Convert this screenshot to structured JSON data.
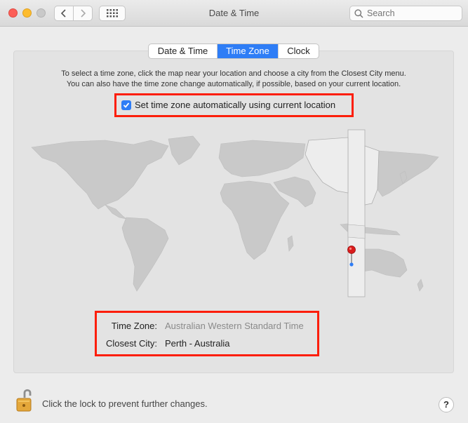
{
  "window": {
    "title": "Date & Time"
  },
  "search": {
    "placeholder": "Search"
  },
  "tabs": [
    {
      "label": "Date & Time",
      "selected": false
    },
    {
      "label": "Time Zone",
      "selected": true
    },
    {
      "label": "Clock",
      "selected": false
    }
  ],
  "instructions": {
    "line1": "To select a time zone, click the map near your location and choose a city from the Closest City menu.",
    "line2": "You can also have the time zone change automatically, if possible, based on your current location."
  },
  "auto_timezone": {
    "label": "Set time zone automatically using current location",
    "checked": true
  },
  "info": {
    "time_zone_label": "Time Zone:",
    "time_zone_value": "Australian Western Standard Time",
    "closest_city_label": "Closest City:",
    "closest_city_value": "Perth - Australia"
  },
  "footer": {
    "lock_text": "Click the lock to prevent further changes.",
    "help_label": "?"
  },
  "colors": {
    "accent": "#2e7df6",
    "highlight": "#fc1e0a",
    "land": "#c9c9c9",
    "selected_zone": "#ededed"
  }
}
